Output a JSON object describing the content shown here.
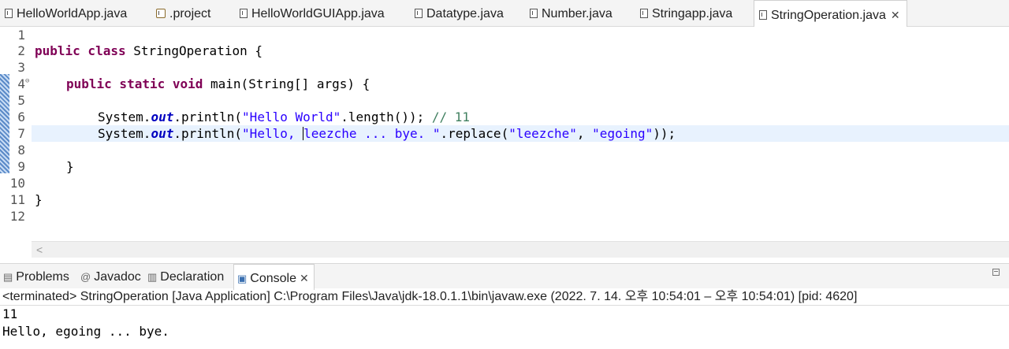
{
  "editor_tabs": [
    {
      "label": "HelloWorldApp.java",
      "active": false
    },
    {
      "label": ".project",
      "active": false
    },
    {
      "label": "HelloWorldGUIApp.java",
      "active": false
    },
    {
      "label": "Datatype.java",
      "active": false
    },
    {
      "label": "Number.java",
      "active": false
    },
    {
      "label": "Stringapp.java",
      "active": false
    },
    {
      "label": "StringOperation.java",
      "active": true
    }
  ],
  "close_glyph": "✕",
  "line_numbers": [
    "1",
    "2",
    "3",
    "4",
    "5",
    "6",
    "7",
    "8",
    "9",
    "10",
    "11",
    "12"
  ],
  "code": {
    "l2_kw": "public class",
    "l2_rest": " StringOperation {",
    "l4_kw": "public static void",
    "l4_rest": " main(String[] args) {",
    "sys": "System.",
    "out": "out",
    "println": ".println(",
    "l6_str": "\"Hello World\"",
    "l6_rest": ".length()); ",
    "l6_comment": "// 11",
    "l7_str_a": "\"Hello, ",
    "l7_str_b": "leezche ... bye. \"",
    "l7_mid": ".replace(",
    "l7_arg1": "\"leezche\"",
    "l7_sep": ", ",
    "l7_arg2": "\"egoing\"",
    "l7_end": "));",
    "l9": "}",
    "l11": "}"
  },
  "console_tabs": [
    {
      "label": "Problems",
      "icon": "problems-icon",
      "active": false
    },
    {
      "label": "Javadoc",
      "icon": "at-icon",
      "active": false
    },
    {
      "label": "Declaration",
      "icon": "declaration-icon",
      "active": false
    },
    {
      "label": "Console",
      "icon": "console-icon",
      "active": true
    }
  ],
  "console": {
    "status": "<terminated> StringOperation [Java Application] C:\\Program Files\\Java\\jdk-18.0.1.1\\bin\\javaw.exe  (2022. 7. 14. 오후 10:54:01 – 오후 10:54:01) [pid: 4620]",
    "output": [
      "11",
      "Hello, egoing ... bye."
    ]
  }
}
